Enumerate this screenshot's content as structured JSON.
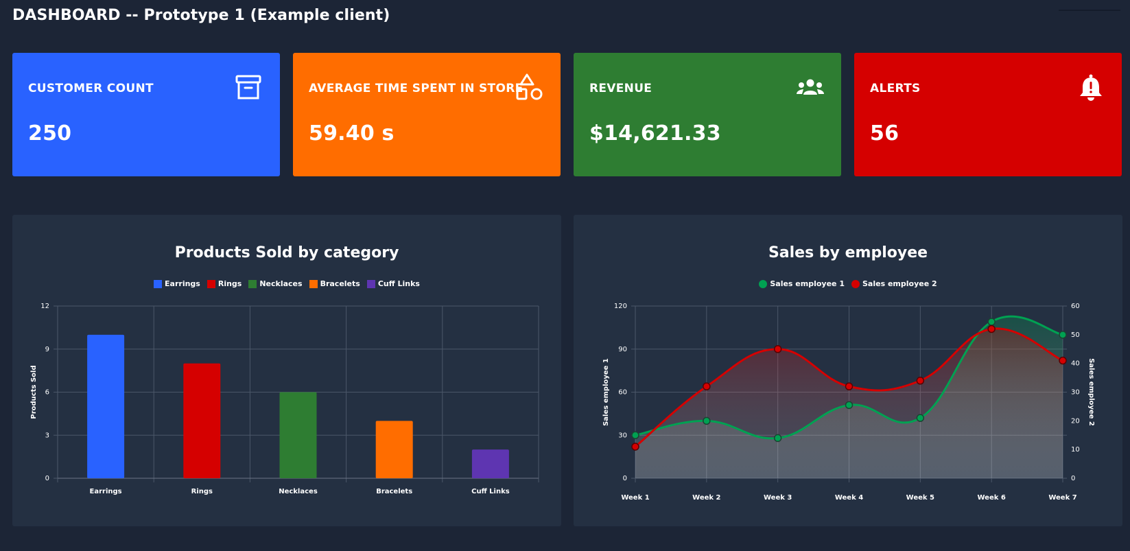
{
  "header": {
    "title": "DASHBOARD -- Prototype 1 (Example client)"
  },
  "kpis": [
    {
      "title": "CUSTOMER COUNT",
      "value": "250",
      "icon": "archive-icon",
      "color": "#2962ff"
    },
    {
      "title": "AVERAGE TIME SPENT IN STORE",
      "value": "59.40 s",
      "icon": "shapes-icon",
      "color": "#ff6d00"
    },
    {
      "title": "REVENUE",
      "value": "$14,621.33",
      "icon": "users-icon",
      "color": "#2e7d32"
    },
    {
      "title": "ALERTS",
      "value": "56",
      "icon": "bell-alert-icon",
      "color": "#d50000"
    }
  ],
  "chart_data": [
    {
      "type": "bar",
      "title": "Products Sold by category",
      "categories": [
        "Earrings",
        "Rings",
        "Necklaces",
        "Bracelets",
        "Cuff Links"
      ],
      "values": [
        10,
        8,
        6,
        4,
        2
      ],
      "colors": [
        "#2962ff",
        "#d50000",
        "#2e7d32",
        "#ff6d00",
        "#5e35b1"
      ],
      "legend": [
        "Earrings",
        "Rings",
        "Necklaces",
        "Bracelets",
        "Cuff Links"
      ],
      "ylabel": "Products Sold",
      "ylim": [
        0,
        12
      ],
      "yticks": [
        0,
        3,
        6,
        9,
        12
      ],
      "grid": true,
      "legend_position": "top"
    },
    {
      "type": "line",
      "title": "Sales by employee",
      "x": [
        "Week 1",
        "Week 2",
        "Week 3",
        "Week 4",
        "Week 5",
        "Week 6",
        "Week 7"
      ],
      "series": [
        {
          "name": "Sales employee 1",
          "axis": "left",
          "color": "#00a152",
          "values": [
            30,
            40,
            28,
            51,
            42,
            109,
            100
          ]
        },
        {
          "name": "Sales employee 2",
          "axis": "right",
          "color": "#d50000",
          "values": [
            11,
            32,
            45,
            32,
            34,
            52,
            41
          ]
        }
      ],
      "ylabel_left": "Sales employee 1",
      "ylabel_right": "Sales employee 2",
      "ylim_left": [
        0,
        120
      ],
      "yticks_left": [
        0,
        30,
        60,
        90,
        120
      ],
      "ylim_right": [
        0,
        60
      ],
      "yticks_right": [
        0,
        10,
        20,
        30,
        40,
        50,
        60
      ],
      "grid": true,
      "legend_position": "top"
    }
  ]
}
